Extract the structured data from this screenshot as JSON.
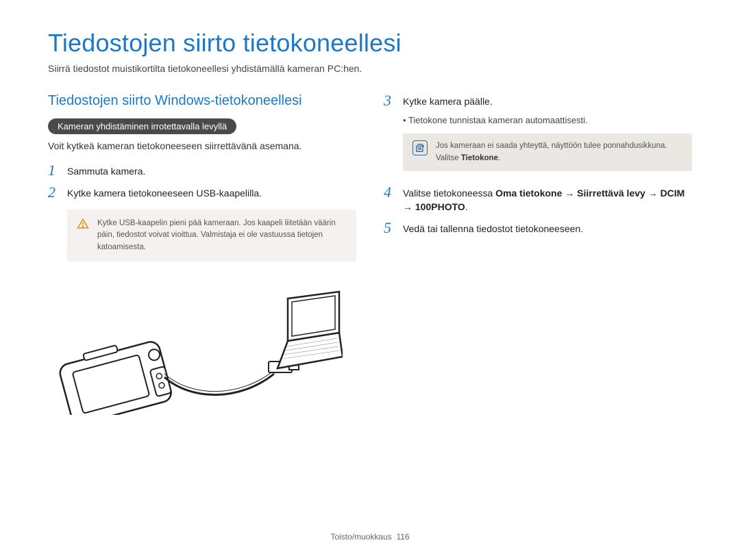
{
  "title": "Tiedostojen siirto tietokoneellesi",
  "subtitle": "Siirrä tiedostot muistikortilta tietokoneellesi yhdistämällä kameran PC:hen.",
  "left": {
    "heading": "Tiedostojen siirto Windows-tietokoneellesi",
    "pill": "Kameran yhdistäminen irrotettavalla levyllä",
    "desc": "Voit kytkeä kameran tietokoneeseen siirrettävänä asemana.",
    "step1_num": "1",
    "step1_text": "Sammuta kamera.",
    "step2_num": "2",
    "step2_text": "Kytke kamera tietokoneeseen USB-kaapelilla.",
    "warning": "Kytke USB-kaapelin pieni pää kameraan. Jos kaapeli liitetään väärin päin, tiedostot voivat vioittua. Valmistaja ei ole vastuussa tietojen katoamisesta."
  },
  "right": {
    "step3_num": "3",
    "step3_text": "Kytke kamera päälle.",
    "step3_bullet": "Tietokone tunnistaa kameran automaattisesti.",
    "note_prefix": "Jos kameraan ei saada yhteyttä, näyttöön tulee ponnahdusikkuna. Valitse ",
    "note_bold": "Tietokone",
    "note_suffix": ".",
    "step4_num": "4",
    "step4_prefix": "Valitse tietokoneessa ",
    "step4_path": "Oma tietokone → Siirrettävä levy → DCIM → 100PHOTO",
    "step4_suffix": ".",
    "step5_num": "5",
    "step5_text": "Vedä tai tallenna tiedostot tietokoneeseen."
  },
  "footer_label": "Toisto/muokkaus",
  "footer_page": "116"
}
